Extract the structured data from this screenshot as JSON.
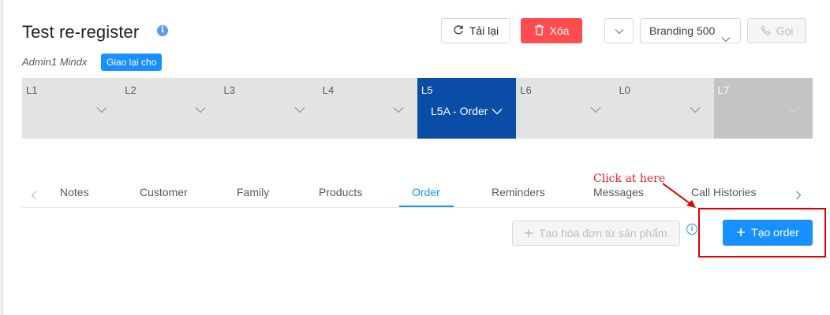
{
  "header": {
    "title": "Test re-register",
    "owner": "Admin1 Mindx",
    "assign_label": "Giao lại cho",
    "reload_label": "Tải lại",
    "delete_label": "Xóa",
    "branding_value": "Branding 500",
    "call_label": "Gọi"
  },
  "stages": [
    {
      "label": "L1",
      "value": ""
    },
    {
      "label": "L2",
      "value": ""
    },
    {
      "label": "L3",
      "value": ""
    },
    {
      "label": "L4",
      "value": ""
    },
    {
      "label": "L5",
      "value": "L5A - Order"
    },
    {
      "label": "L6",
      "value": ""
    },
    {
      "label": "L0",
      "value": ""
    },
    {
      "label": "L7",
      "value": ""
    }
  ],
  "tabs": [
    {
      "label": "Notes"
    },
    {
      "label": "Customer"
    },
    {
      "label": "Family"
    },
    {
      "label": "Products"
    },
    {
      "label": "Order"
    },
    {
      "label": "Reminders"
    },
    {
      "label": "Messages"
    },
    {
      "label": "Call Histories"
    }
  ],
  "active_tab": "Order",
  "annotation": {
    "text": "Click at here",
    "color": "#e02020"
  },
  "actions": {
    "invoice_label": "Tạo hóa đơn từ sản phẩm",
    "create_order_label": "Tạo order"
  },
  "colors": {
    "primary": "#1890ff",
    "danger": "#ff4d4f",
    "stage_active": "#0a4da6"
  }
}
